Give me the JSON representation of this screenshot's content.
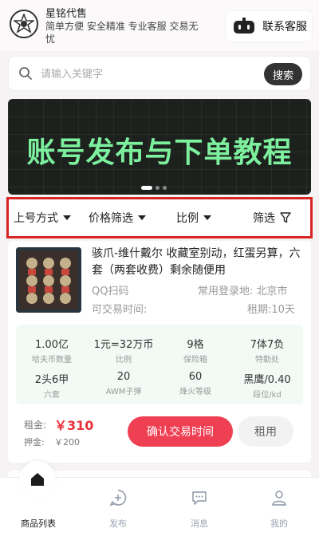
{
  "header": {
    "brand_name": "星铭代售",
    "slogan": "简单方便 安全精准 专业客服 交易无忧",
    "contact_label": "联系客服"
  },
  "search": {
    "placeholder": "请输入关键字",
    "button_label": "搜索"
  },
  "banner": {
    "title": "账号发布与下单教程",
    "title_color": "#7df09e",
    "slides_count": 3,
    "active_slide": 1
  },
  "filters": [
    {
      "label": "上号方式",
      "icon": "chevron-down-icon"
    },
    {
      "label": "价格筛选",
      "icon": "chevron-down-icon"
    },
    {
      "label": "比例",
      "icon": "chevron-down-icon"
    },
    {
      "label": "筛选",
      "icon": "funnel-icon"
    }
  ],
  "listing": {
    "title": "骇爪-维什戴尔 收藏室别动，红蛋另算，六套（两套收费）剩余随便用",
    "login_method": "QQ扫码",
    "login_location": "常用登录地: 北京市",
    "trade_time_label": "可交易时间:",
    "rental_period": "租期:10天",
    "stats": [
      {
        "value": "1.00亿",
        "label": "哈夫币数量"
      },
      {
        "value": "1元=32万币",
        "label": "比例"
      },
      {
        "value": "9格",
        "label": "保险箱"
      },
      {
        "value": "7体7负",
        "label": "特勤处"
      },
      {
        "value": "2头6甲",
        "label": "六套"
      },
      {
        "value": "20",
        "label": "AWM子弹"
      },
      {
        "value": "60",
        "label": "烽火等级"
      },
      {
        "value": "黑鹰/0.40",
        "label": "段位/kd"
      }
    ],
    "rent_label": "租金:",
    "rent_price": "￥310",
    "deposit_label": "押金:",
    "deposit_value": "￥200",
    "confirm_button": "确认交易时间",
    "rent_button": "租用"
  },
  "tabbar": [
    {
      "label": "商品列表",
      "icon": "home-icon",
      "active": true
    },
    {
      "label": "发布",
      "icon": "publish-icon",
      "active": false
    },
    {
      "label": "消息",
      "icon": "message-icon",
      "active": false
    },
    {
      "label": "我的",
      "icon": "user-icon",
      "active": false
    }
  ],
  "colors": {
    "accent": "#ef3f53",
    "highlight_border": "#d82626",
    "stats_bg": "#f1faf5"
  }
}
